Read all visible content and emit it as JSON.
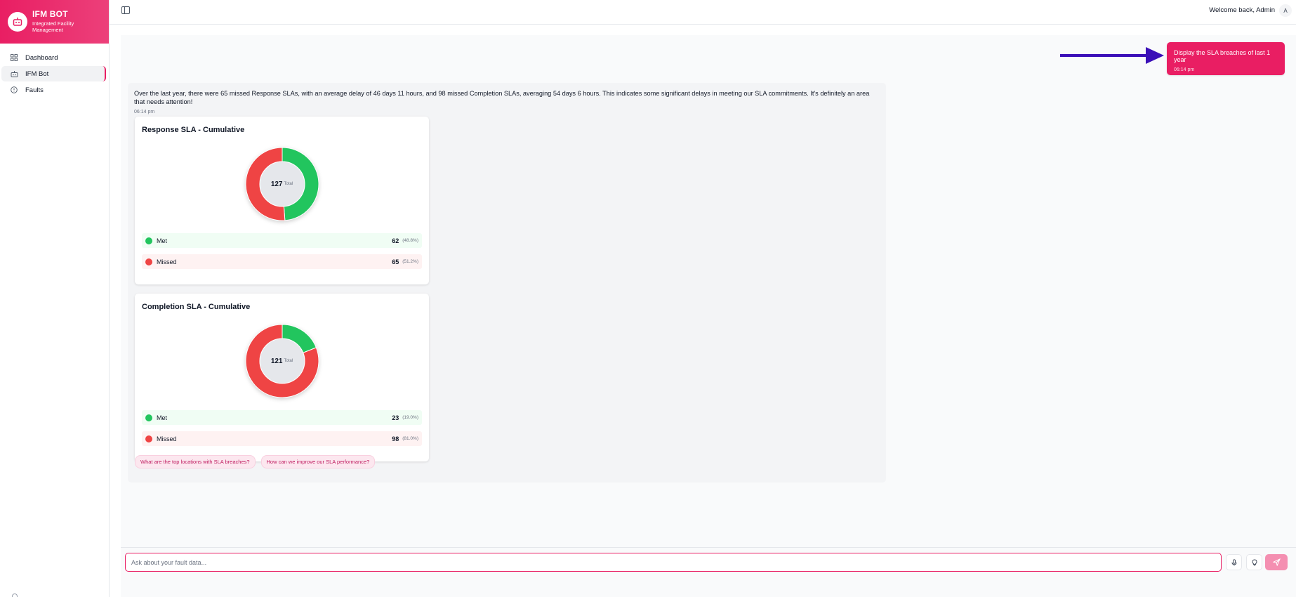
{
  "brand": {
    "title": "IFM BOT",
    "subtitle": "Integrated Facility Management",
    "logo_icon": "robot-icon"
  },
  "sidebar": {
    "items": [
      {
        "label": "Dashboard",
        "icon": "dashboard-icon",
        "active": false
      },
      {
        "label": "IFM Bot",
        "icon": "bot-icon",
        "active": true
      },
      {
        "label": "Faults",
        "icon": "alert-circle-icon",
        "active": false
      }
    ]
  },
  "header": {
    "welcome": "Welcome back, Admin",
    "avatar_initial": "A"
  },
  "colors": {
    "accent": "#e91e63",
    "met": "#22c55e",
    "missed": "#ef4444"
  },
  "chat": {
    "user_message": {
      "text": "Display the SLA breaches of last 1 year",
      "time": "06:14 pm"
    },
    "bot_message": {
      "text": "Over the last year, there were 65 missed Response SLAs, with an average delay of 46 days 11 hours, and 98 missed Completion SLAs, averaging 54 days 6 hours. This indicates some significant delays in meeting our SLA commitments. It's definitely an area that needs attention!",
      "time": "06:14 pm"
    },
    "suggestions": [
      "What are the top locations with SLA breaches?",
      "How can we improve our SLA performance?"
    ]
  },
  "chart_data": [
    {
      "type": "pie",
      "title": "Response SLA - Cumulative",
      "center_value": "127",
      "center_label": "Total",
      "categories": [
        "Met",
        "Missed"
      ],
      "values": [
        62,
        65
      ],
      "percent_labels": [
        "(48.8%)",
        "(51.2%)"
      ],
      "colors": [
        "#22c55e",
        "#ef4444"
      ]
    },
    {
      "type": "pie",
      "title": "Completion SLA - Cumulative",
      "center_value": "121",
      "center_label": "Total",
      "categories": [
        "Met",
        "Missed"
      ],
      "values": [
        23,
        98
      ],
      "percent_labels": [
        "(19.0%)",
        "(81.0%)"
      ],
      "colors": [
        "#22c55e",
        "#ef4444"
      ]
    }
  ],
  "input": {
    "placeholder": "Ask about your fault data...",
    "value": ""
  }
}
